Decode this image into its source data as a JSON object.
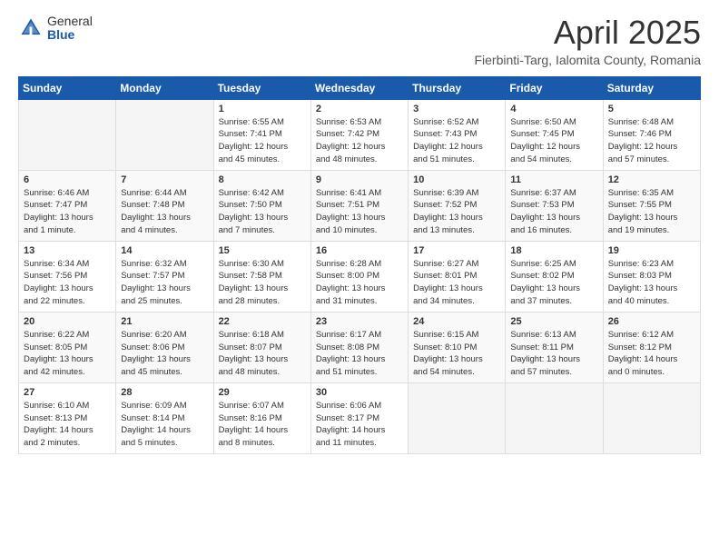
{
  "header": {
    "logo_general": "General",
    "logo_blue": "Blue",
    "month_title": "April 2025",
    "location": "Fierbinti-Targ, Ialomita County, Romania"
  },
  "days_of_week": [
    "Sunday",
    "Monday",
    "Tuesday",
    "Wednesday",
    "Thursday",
    "Friday",
    "Saturday"
  ],
  "weeks": [
    [
      {
        "day": "",
        "detail": ""
      },
      {
        "day": "",
        "detail": ""
      },
      {
        "day": "1",
        "detail": "Sunrise: 6:55 AM\nSunset: 7:41 PM\nDaylight: 12 hours\nand 45 minutes."
      },
      {
        "day": "2",
        "detail": "Sunrise: 6:53 AM\nSunset: 7:42 PM\nDaylight: 12 hours\nand 48 minutes."
      },
      {
        "day": "3",
        "detail": "Sunrise: 6:52 AM\nSunset: 7:43 PM\nDaylight: 12 hours\nand 51 minutes."
      },
      {
        "day": "4",
        "detail": "Sunrise: 6:50 AM\nSunset: 7:45 PM\nDaylight: 12 hours\nand 54 minutes."
      },
      {
        "day": "5",
        "detail": "Sunrise: 6:48 AM\nSunset: 7:46 PM\nDaylight: 12 hours\nand 57 minutes."
      }
    ],
    [
      {
        "day": "6",
        "detail": "Sunrise: 6:46 AM\nSunset: 7:47 PM\nDaylight: 13 hours\nand 1 minute."
      },
      {
        "day": "7",
        "detail": "Sunrise: 6:44 AM\nSunset: 7:48 PM\nDaylight: 13 hours\nand 4 minutes."
      },
      {
        "day": "8",
        "detail": "Sunrise: 6:42 AM\nSunset: 7:50 PM\nDaylight: 13 hours\nand 7 minutes."
      },
      {
        "day": "9",
        "detail": "Sunrise: 6:41 AM\nSunset: 7:51 PM\nDaylight: 13 hours\nand 10 minutes."
      },
      {
        "day": "10",
        "detail": "Sunrise: 6:39 AM\nSunset: 7:52 PM\nDaylight: 13 hours\nand 13 minutes."
      },
      {
        "day": "11",
        "detail": "Sunrise: 6:37 AM\nSunset: 7:53 PM\nDaylight: 13 hours\nand 16 minutes."
      },
      {
        "day": "12",
        "detail": "Sunrise: 6:35 AM\nSunset: 7:55 PM\nDaylight: 13 hours\nand 19 minutes."
      }
    ],
    [
      {
        "day": "13",
        "detail": "Sunrise: 6:34 AM\nSunset: 7:56 PM\nDaylight: 13 hours\nand 22 minutes."
      },
      {
        "day": "14",
        "detail": "Sunrise: 6:32 AM\nSunset: 7:57 PM\nDaylight: 13 hours\nand 25 minutes."
      },
      {
        "day": "15",
        "detail": "Sunrise: 6:30 AM\nSunset: 7:58 PM\nDaylight: 13 hours\nand 28 minutes."
      },
      {
        "day": "16",
        "detail": "Sunrise: 6:28 AM\nSunset: 8:00 PM\nDaylight: 13 hours\nand 31 minutes."
      },
      {
        "day": "17",
        "detail": "Sunrise: 6:27 AM\nSunset: 8:01 PM\nDaylight: 13 hours\nand 34 minutes."
      },
      {
        "day": "18",
        "detail": "Sunrise: 6:25 AM\nSunset: 8:02 PM\nDaylight: 13 hours\nand 37 minutes."
      },
      {
        "day": "19",
        "detail": "Sunrise: 6:23 AM\nSunset: 8:03 PM\nDaylight: 13 hours\nand 40 minutes."
      }
    ],
    [
      {
        "day": "20",
        "detail": "Sunrise: 6:22 AM\nSunset: 8:05 PM\nDaylight: 13 hours\nand 42 minutes."
      },
      {
        "day": "21",
        "detail": "Sunrise: 6:20 AM\nSunset: 8:06 PM\nDaylight: 13 hours\nand 45 minutes."
      },
      {
        "day": "22",
        "detail": "Sunrise: 6:18 AM\nSunset: 8:07 PM\nDaylight: 13 hours\nand 48 minutes."
      },
      {
        "day": "23",
        "detail": "Sunrise: 6:17 AM\nSunset: 8:08 PM\nDaylight: 13 hours\nand 51 minutes."
      },
      {
        "day": "24",
        "detail": "Sunrise: 6:15 AM\nSunset: 8:10 PM\nDaylight: 13 hours\nand 54 minutes."
      },
      {
        "day": "25",
        "detail": "Sunrise: 6:13 AM\nSunset: 8:11 PM\nDaylight: 13 hours\nand 57 minutes."
      },
      {
        "day": "26",
        "detail": "Sunrise: 6:12 AM\nSunset: 8:12 PM\nDaylight: 14 hours\nand 0 minutes."
      }
    ],
    [
      {
        "day": "27",
        "detail": "Sunrise: 6:10 AM\nSunset: 8:13 PM\nDaylight: 14 hours\nand 2 minutes."
      },
      {
        "day": "28",
        "detail": "Sunrise: 6:09 AM\nSunset: 8:14 PM\nDaylight: 14 hours\nand 5 minutes."
      },
      {
        "day": "29",
        "detail": "Sunrise: 6:07 AM\nSunset: 8:16 PM\nDaylight: 14 hours\nand 8 minutes."
      },
      {
        "day": "30",
        "detail": "Sunrise: 6:06 AM\nSunset: 8:17 PM\nDaylight: 14 hours\nand 11 minutes."
      },
      {
        "day": "",
        "detail": ""
      },
      {
        "day": "",
        "detail": ""
      },
      {
        "day": "",
        "detail": ""
      }
    ]
  ]
}
